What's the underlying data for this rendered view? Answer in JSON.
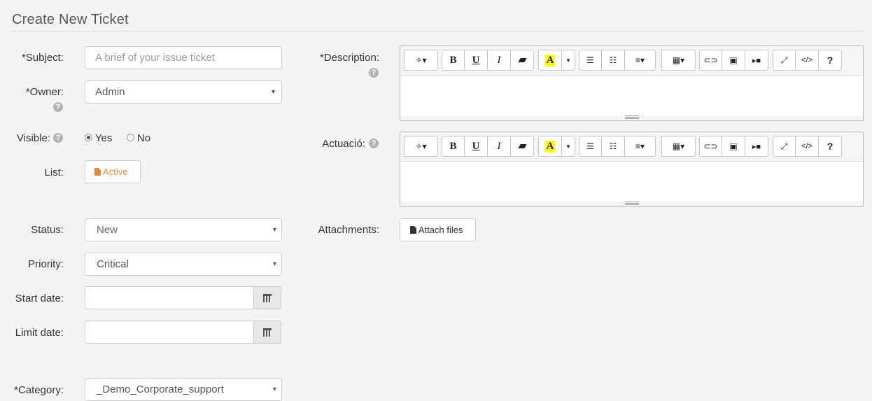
{
  "page": {
    "title": "Create New Ticket"
  },
  "form": {
    "subject": {
      "label": "*Subject:",
      "placeholder": "A brief of your issue ticket",
      "value": ""
    },
    "owner": {
      "label": "*Owner:",
      "value": "Admin"
    },
    "visible": {
      "label": "Visible:",
      "options": [
        "Yes",
        "No"
      ],
      "selected": "Yes"
    },
    "list": {
      "label": "List:",
      "button": "Active"
    },
    "status": {
      "label": "Status:",
      "value": "New"
    },
    "priority": {
      "label": "Priority:",
      "value": "Critical"
    },
    "start_date": {
      "label": "Start date:",
      "value": ""
    },
    "limit_date": {
      "label": "Limit date:",
      "value": ""
    },
    "category": {
      "label": "*Category:",
      "value": "_Demo_Corporate_support"
    },
    "description": {
      "label": "*Description:"
    },
    "actuacio": {
      "label": "Actuació:"
    },
    "attachments": {
      "label": "Attachments:",
      "button": "Attach files"
    }
  },
  "editor_toolbar": {
    "groups": [
      [
        "magic-wand-icon"
      ],
      [
        "bold-icon",
        "underline-icon",
        "italic-icon",
        "eraser-icon"
      ],
      [
        "text-color-icon"
      ],
      [
        "unordered-list-icon",
        "ordered-list-icon",
        "paragraph-align-icon"
      ],
      [
        "table-icon"
      ],
      [
        "link-icon",
        "picture-icon",
        "video-icon"
      ],
      [
        "fullscreen-icon",
        "code-view-icon",
        "help-icon"
      ]
    ],
    "glyphs": {
      "bold": "B",
      "underline": "U",
      "italic": "I",
      "color": "A",
      "code": "</>",
      "help": "?"
    }
  },
  "colors": {
    "accent_orange": "#e08a3c",
    "highlight_yellow": "#ffff00",
    "help_gray": "#b4b4b4"
  }
}
